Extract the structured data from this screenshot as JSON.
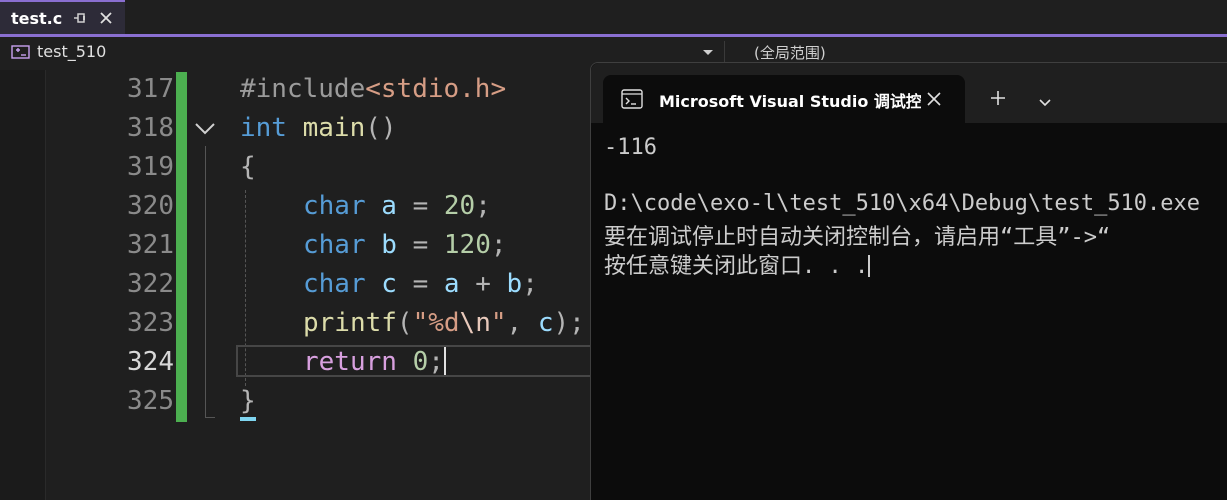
{
  "tab": {
    "title": "test.c"
  },
  "navbar": {
    "project": "test_510",
    "scope": "(全局范围)"
  },
  "editor": {
    "line_numbers": [
      "317",
      "318",
      "319",
      "320",
      "321",
      "322",
      "323",
      "324",
      "325"
    ],
    "current_line": "324",
    "code": {
      "l317": {
        "directive": "#include",
        "header": "<stdio.h>"
      },
      "l318": {
        "type": "int",
        "name": "main",
        "parens": "()"
      },
      "l319": {
        "brace": "{"
      },
      "l320": {
        "type": "char",
        "var": "a",
        "op": " = ",
        "value": "20",
        "end": ";"
      },
      "l321": {
        "type": "char",
        "var": "b",
        "op": " = ",
        "value": "120",
        "end": ";"
      },
      "l322": {
        "type": "char",
        "var": "c",
        "op": " = ",
        "lhs": "a",
        "plus": " + ",
        "rhs": "b",
        "end": ";"
      },
      "l323": {
        "func": "printf",
        "open": "(",
        "str_a": "\"%d",
        "esc": "\\n",
        "str_b": "\"",
        "args": ", ",
        "arg": "c",
        "close": ");"
      },
      "l324": {
        "keyword": "return",
        "value": "0",
        "end": ";"
      },
      "l325": {
        "brace": "}"
      }
    }
  },
  "console": {
    "title": "Microsoft Visual Studio 调试控制台",
    "output": {
      "result": "-116",
      "path": "D:\\code\\exo-l\\test_510\\x64\\Debug\\test_510.exe",
      "hint": "要在调试停止时自动关闭控制台，请启用“工具”->“",
      "prompt": "按任意键关闭此窗口. . ."
    }
  },
  "colors": {
    "accent": "#8a6fd1",
    "change_bar": "#4caf50",
    "keyword": "#569cd6",
    "function": "#dcdcaa",
    "identifier": "#9cdcfe",
    "number": "#b5cea8",
    "string": "#d69d85",
    "return_keyword": "#d8a0df"
  },
  "icons": {
    "tab_pin": "pin-icon",
    "tab_close": "close-icon",
    "project": "project-icon",
    "fold": "chevron-down-icon",
    "console": "terminal-icon",
    "new_tab": "plus-icon",
    "dropdown": "chevron-down-icon"
  }
}
